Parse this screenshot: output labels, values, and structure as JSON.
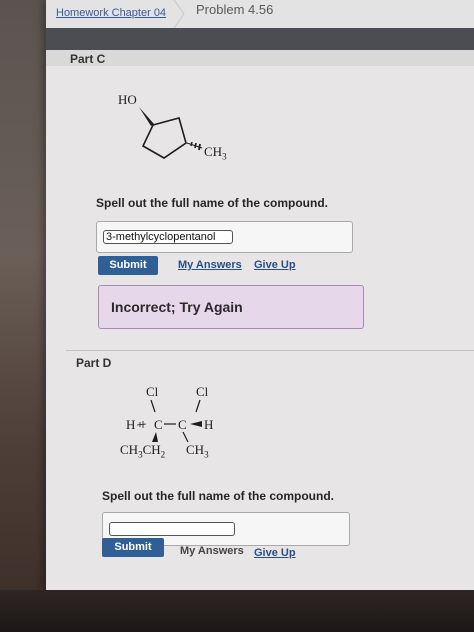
{
  "breadcrumb": {
    "link": "Homework Chapter 04",
    "current": "Problem 4.56"
  },
  "part_c": {
    "label": "Part C",
    "molecule": {
      "oh_label": "HO",
      "ch3_label": "CH",
      "ch3_sub": "3"
    },
    "question": "Spell out the full name of the compound.",
    "answer_value": "3-methylcyclopentanol",
    "submit_label": "Submit",
    "my_answers_label": "My Answers",
    "give_up_label": "Give Up",
    "feedback": "Incorrect; Try Again"
  },
  "part_d": {
    "label": "Part D",
    "molecule": {
      "cl_left": "Cl",
      "cl_right": "Cl",
      "h_left": "H",
      "c_left": "C",
      "c_right": "C",
      "h_right": "H",
      "ethyl": "CH",
      "ethyl_sub1": "3",
      "ethyl_ch2": "CH",
      "ethyl_sub2": "2",
      "methyl": "CH",
      "methyl_sub": "3"
    },
    "question": "Spell out the full name of the compound.",
    "answer_value": "",
    "submit_label": "Submit",
    "my_answers_label": "My Answers",
    "give_up_label": "Give Up"
  },
  "colors": {
    "submit": "#2f5f95",
    "feedback_bg": "#e6d7ea",
    "link": "#2a4f86"
  }
}
